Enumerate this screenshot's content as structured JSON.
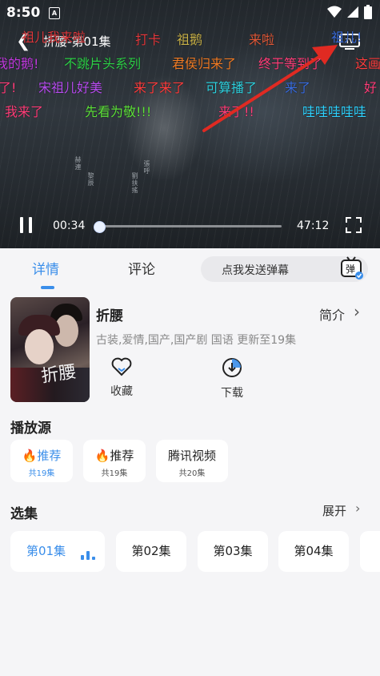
{
  "status_bar": {
    "time": "8:50",
    "sim_label": "A"
  },
  "player": {
    "title": "折腰-第01集",
    "tv_label": "TV",
    "current_time": "00:34",
    "duration": "47:12",
    "progress": 0.012,
    "vertical_texts": [
      "赫連",
      "黎辰",
      "劉扶搖",
      "張呼"
    ]
  },
  "danmaku": [
    {
      "text": "祖儿我来啦",
      "color": "#e0393d"
    },
    {
      "text": "打卡",
      "color": "#e0393d"
    },
    {
      "text": "祖鹅",
      "color": "#c9b24a"
    },
    {
      "text": "来啦",
      "color": "#e05a3a"
    },
    {
      "text": "祖儿!",
      "color": "#3b6ee0"
    },
    {
      "text": "我的鹅!",
      "color": "#c23be0"
    },
    {
      "text": "不跳片头系列",
      "color": "#2fd24a"
    },
    {
      "text": "君侯归来了",
      "color": "#f07c26"
    },
    {
      "text": "终于等到了",
      "color": "#ff3f7a"
    },
    {
      "text": "这画",
      "color": "#ff3f3f"
    },
    {
      "text": "了!",
      "color": "#ff3f7a"
    },
    {
      "text": "宋祖儿好美",
      "color": "#b84df0"
    },
    {
      "text": "来了来了",
      "color": "#ff3f3f"
    },
    {
      "text": "可算播了",
      "color": "#2fd2e0"
    },
    {
      "text": "来了",
      "color": "#3b6ee0"
    },
    {
      "text": "好",
      "color": "#ff3f7a"
    },
    {
      "text": "我来了",
      "color": "#ff3f7a"
    },
    {
      "text": "先看为敬!!!",
      "color": "#5ee03b"
    },
    {
      "text": "来了!!",
      "color": "#ff3f7a"
    },
    {
      "text": "哇哇哇哇哇",
      "color": "#2fd2ff"
    }
  ],
  "tabs": [
    {
      "label": "详情",
      "active": true
    },
    {
      "label": "评论",
      "active": false
    }
  ],
  "danmaku_input": {
    "placeholder": "点我发送弹幕",
    "button_label": "弹"
  },
  "show": {
    "name": "折腰",
    "intro_label": "简介",
    "tags": "古装,爱情,国产,国产剧 国语 更新至19集",
    "poster_title": "折腰",
    "actions": [
      {
        "label": "收藏",
        "icon": "heart-icon"
      },
      {
        "label": "下载",
        "icon": "download-icon"
      }
    ]
  },
  "sources": {
    "title": "播放源",
    "items": [
      {
        "name": "推荐",
        "count": "共19集",
        "hot": true,
        "active": true
      },
      {
        "name": "推荐",
        "count": "共19集",
        "hot": true,
        "active": false
      },
      {
        "name": "腾讯视频",
        "count": "共20集",
        "hot": false,
        "active": false
      }
    ]
  },
  "episodes": {
    "title": "选集",
    "more_label": "展开",
    "items": [
      {
        "label": "第01集",
        "active": true
      },
      {
        "label": "第02集",
        "active": false
      },
      {
        "label": "第03集",
        "active": false
      },
      {
        "label": "第04集",
        "active": false
      }
    ]
  },
  "colors": {
    "accent": "#3a8eea",
    "hot": "#f5871f"
  }
}
